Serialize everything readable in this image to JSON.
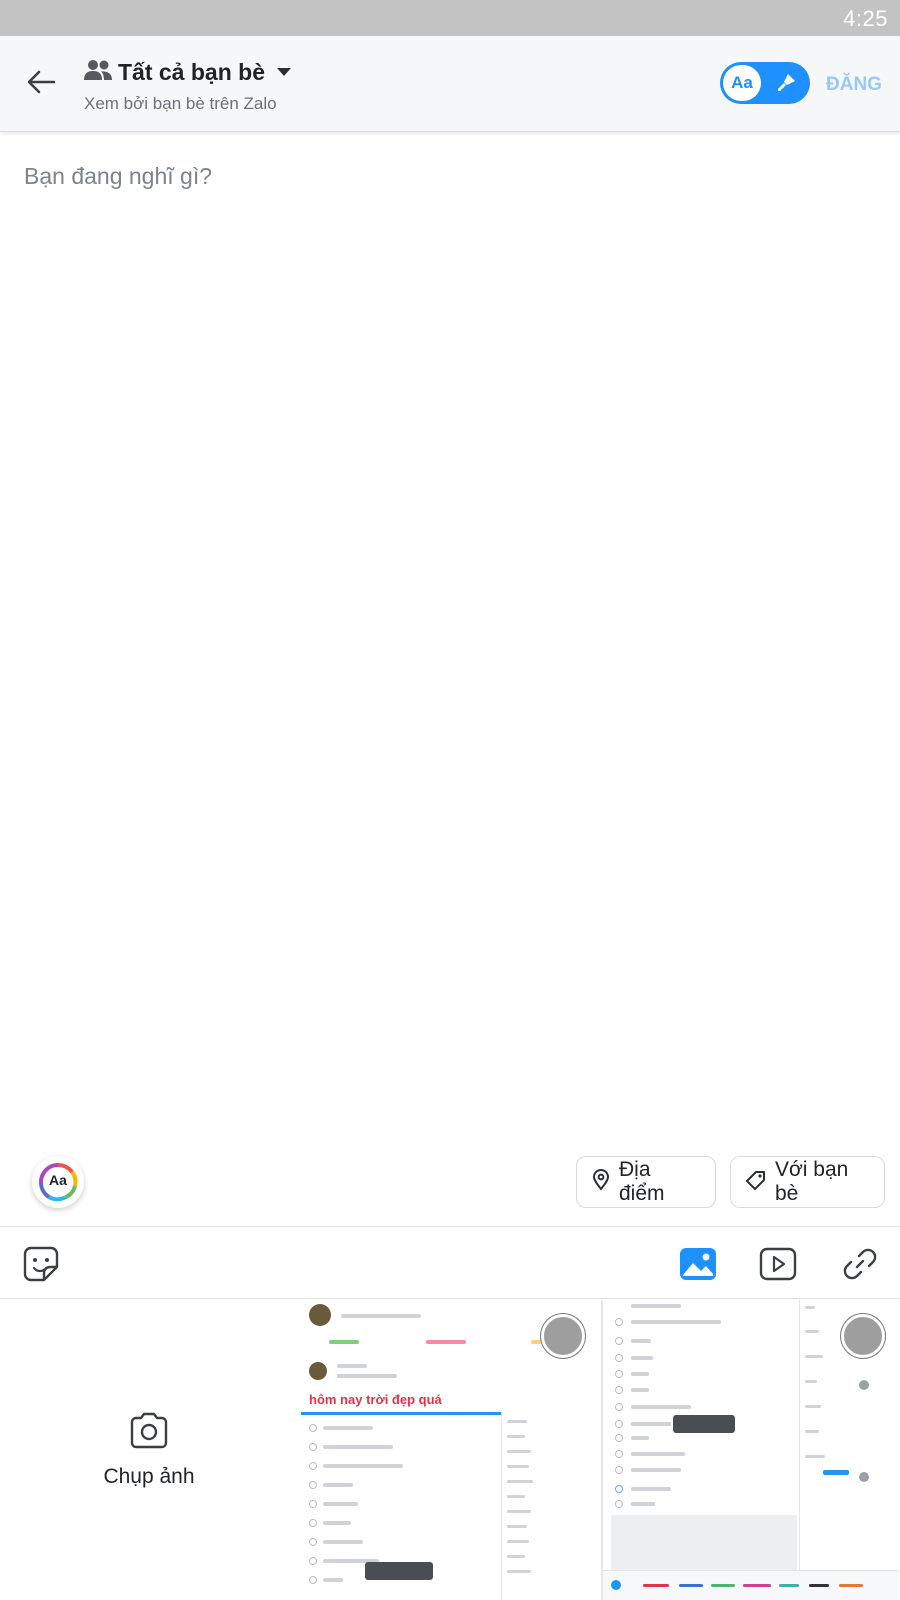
{
  "status_bar": {
    "time": "4:25"
  },
  "header": {
    "audience_title": "Tất cả bạn bè",
    "audience_subtitle": "Xem bởi bạn bè trên Zalo",
    "toggle_text_label": "Aa",
    "post_label": "ĐĂNG",
    "accent_color": "#1e90ff",
    "post_color_disabled": "#9ac8f4"
  },
  "composer": {
    "placeholder": "Bạn đang nghĩ gì?"
  },
  "font_style_button": {
    "label": "Aa"
  },
  "chips": {
    "location": {
      "label": "Địa điểm",
      "icon": "location-pin-icon"
    },
    "friends": {
      "label": "Với bạn bè",
      "icon": "tag-icon"
    }
  },
  "toolbar": {
    "items": [
      "sticker-icon",
      "photo-icon",
      "video-icon",
      "link-icon"
    ],
    "active": "photo-icon"
  },
  "gallery": {
    "camera_label": "Chụp ảnh",
    "thumbnail_1_headline": "hôm nay trời đẹp quá"
  }
}
